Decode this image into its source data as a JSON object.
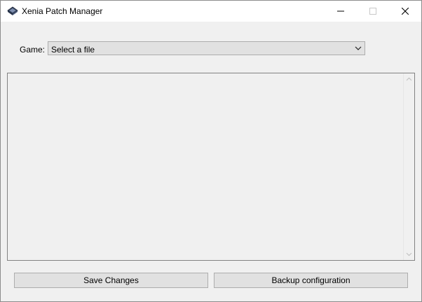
{
  "window": {
    "title": "Xenia Patch Manager",
    "icon": "xenia-app-icon",
    "controls": {
      "minimize": "minimize-icon",
      "maximize": "maximize-icon",
      "close": "close-icon"
    }
  },
  "game_selector": {
    "label": "Game:",
    "selected_value": "Select a file"
  },
  "patch_list": {
    "items": []
  },
  "buttons": {
    "save_label": "Save Changes",
    "backup_label": "Backup configuration"
  },
  "colors": {
    "window_bg": "#f0f0f0",
    "titlebar_bg": "#ffffff",
    "control_bg": "#e1e1e1",
    "control_border": "#adadad"
  }
}
